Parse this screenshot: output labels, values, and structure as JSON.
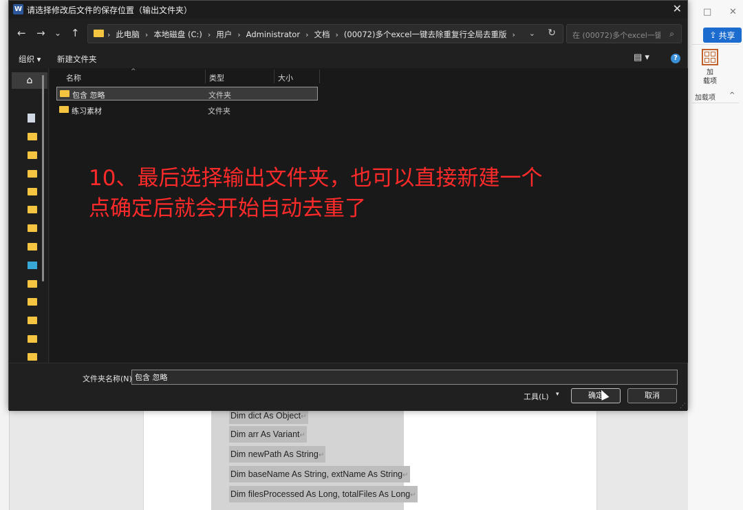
{
  "dialog": {
    "title": "请选择修改后文件的保存位置（输出文件夹）",
    "title_icon": "W",
    "close": "✕"
  },
  "nav": {
    "back": "←",
    "forward": "→",
    "recent": "⌄",
    "up": "↑",
    "refresh": "↻",
    "dropdown": "⌄"
  },
  "address": {
    "crumbs": [
      "此电脑",
      "本地磁盘 (C:)",
      "用户",
      "Administrator",
      "文档",
      "(00072)多个excel一键去除重复行全局去重版"
    ],
    "separator": "›"
  },
  "search": {
    "placeholder": "在 (00072)多个excel一键...",
    "icon": "⌕"
  },
  "toolbar": {
    "organize": "组织 ▾",
    "new_folder": "新建文件夹",
    "view_icon": "▤ ▾",
    "help_icon": "?"
  },
  "columns": {
    "name": "名称",
    "type": "类型",
    "size": "大小",
    "sort_caret": "^"
  },
  "files": [
    {
      "name": "包含 忽略",
      "type": "文件夹",
      "selected": true
    },
    {
      "name": "练习素材",
      "type": "文件夹",
      "selected": false
    }
  ],
  "sidebar": {
    "home_icon": "⌂",
    "items": [
      "document-icon",
      "folder-icon",
      "folder-icon",
      "folder-icon",
      "folder-icon",
      "folder-icon",
      "folder-icon",
      "folder-icon",
      "picture-icon",
      "folder-icon",
      "folder-icon",
      "folder-icon",
      "folder-icon",
      "folder-icon"
    ]
  },
  "overlay": {
    "line1": "10、最后选择输出文件夹，也可以直接新建一个",
    "line2": "点确定后就会开始自动去重了",
    "color": "#ff2a2a"
  },
  "footer": {
    "folder_name_label": "文件夹名称(N):",
    "folder_name_value": "包含 忽略",
    "tools": "工具(L)",
    "tools_caret": "▾",
    "ok": "确定",
    "cancel": "取消"
  },
  "word": {
    "share": "共享",
    "share_icon": "⇪",
    "addin_label": "加\n载项",
    "addin_group": "加载项",
    "collapse": "^",
    "minimize": "□",
    "close": "✕",
    "code_lines": [
      "Dim dict As Object",
      "Dim arr As Variant",
      "Dim newPath As String",
      "Dim baseName As String, extName As String",
      "Dim filesProcessed As Long, totalFiles As Long"
    ],
    "para_mark": "↵"
  }
}
